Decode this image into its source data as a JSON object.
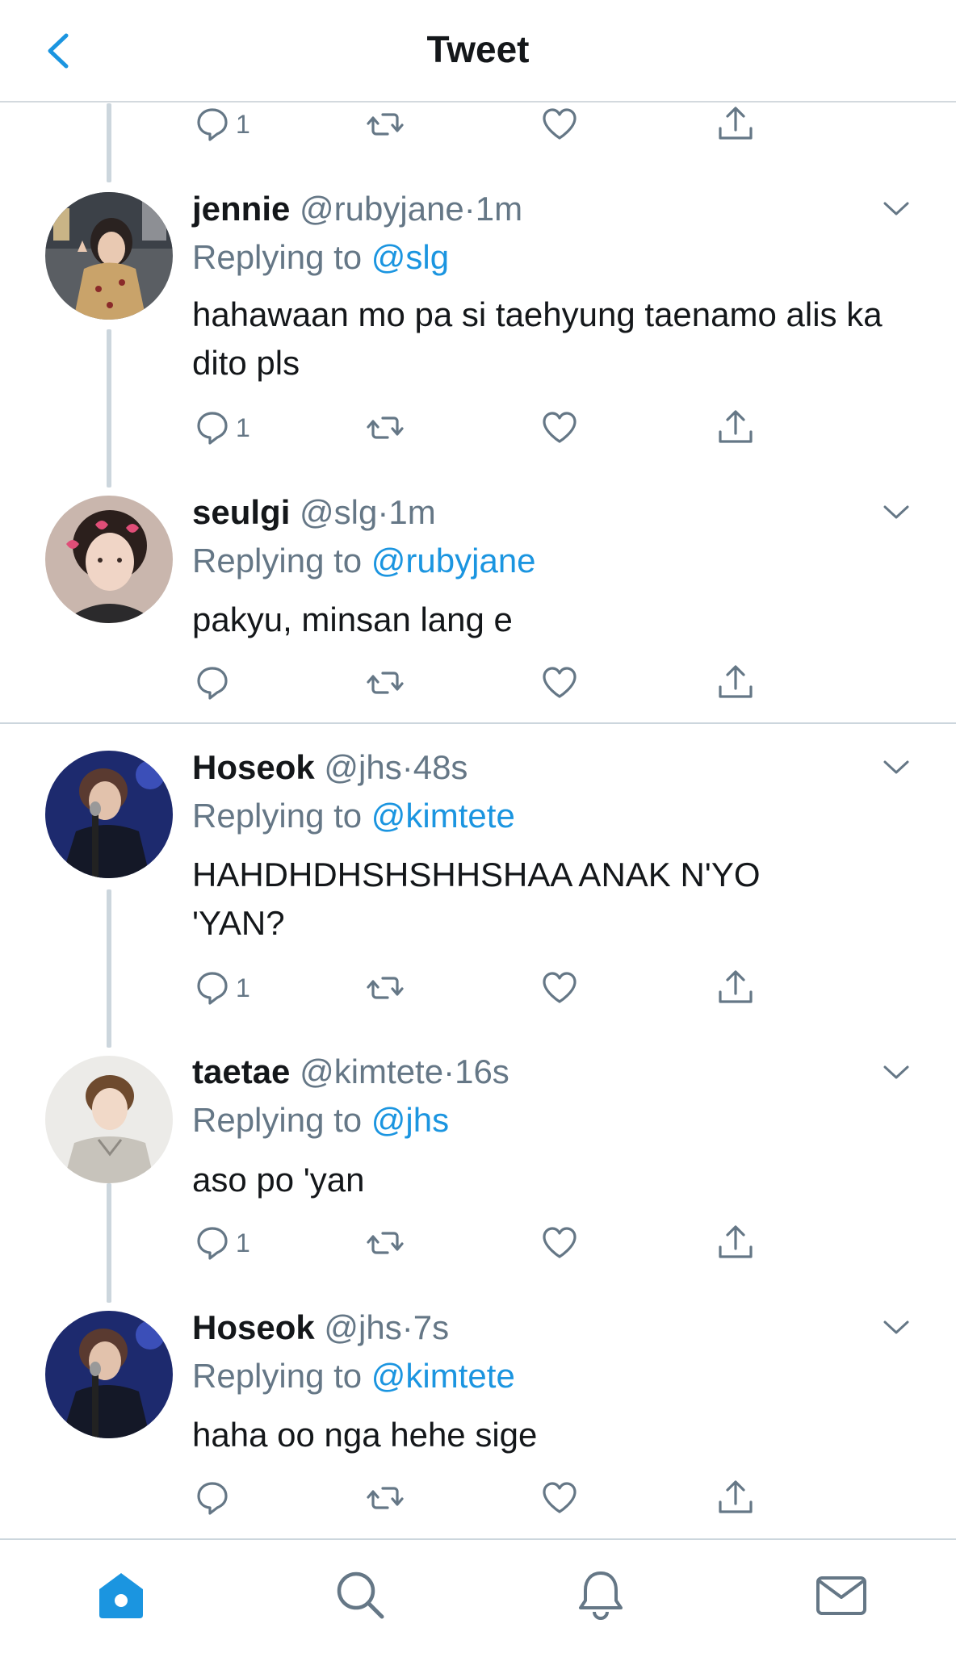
{
  "header": {
    "title": "Tweet",
    "back_icon": "chevron-left-icon"
  },
  "colors": {
    "accent": "#1b95e0",
    "muted": "#657786",
    "text": "#14171a",
    "divider": "#ccd6dd"
  },
  "top_actions": {
    "reply_count": "1"
  },
  "tweets": [
    {
      "name": "jennie",
      "handle": "@rubyjane",
      "time": "1m",
      "replying_prefix": "Replying to",
      "replying_to": "@slg",
      "text": "hahawaan mo pa si taehyung taenamo alis ka dito pls",
      "reply_count": "1"
    },
    {
      "name": "seulgi",
      "handle": "@slg",
      "time": "1m",
      "replying_prefix": "Replying to",
      "replying_to": "@rubyjane",
      "text": "pakyu, minsan lang e",
      "reply_count": ""
    },
    {
      "name": "Hoseok",
      "handle": "@jhs",
      "time": "48s",
      "replying_prefix": "Replying to",
      "replying_to": "@kimtete",
      "text": "HAHDHDHSHSHHSHAA ANAK N'YO 'YAN?",
      "reply_count": "1"
    },
    {
      "name": "taetae",
      "handle": "@kimtete",
      "time": "16s",
      "replying_prefix": "Replying to",
      "replying_to": "@jhs",
      "text": "aso po 'yan",
      "reply_count": "1"
    },
    {
      "name": "Hoseok",
      "handle": "@jhs",
      "time": "7s",
      "replying_prefix": "Replying to",
      "replying_to": "@kimtete",
      "text": "haha oo nga hehe sige",
      "reply_count": ""
    }
  ],
  "tabbar": {
    "items": [
      "home-icon",
      "search-icon",
      "notifications-icon",
      "messages-icon"
    ]
  }
}
